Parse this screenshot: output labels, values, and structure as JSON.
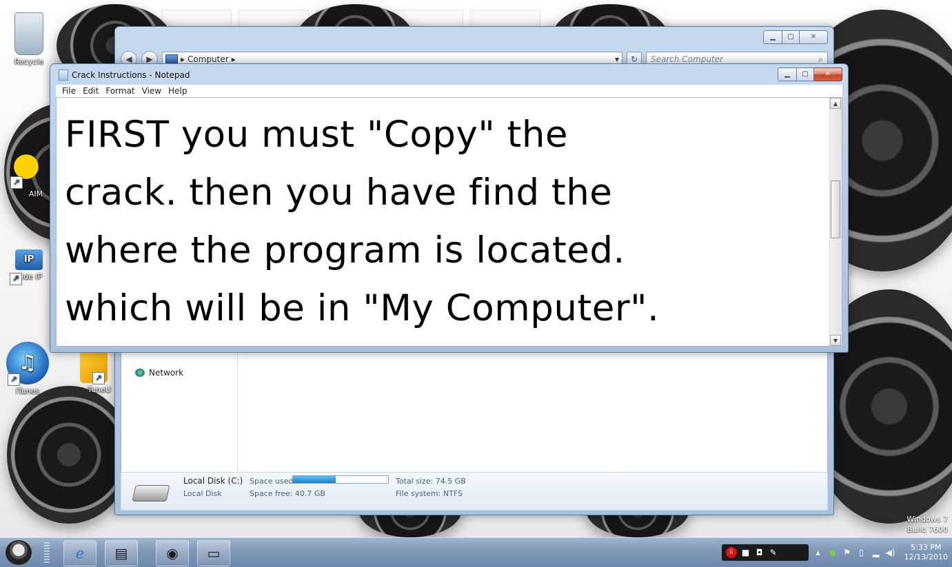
{
  "desktop": {
    "icons": [
      {
        "label": "Recycle",
        "key": "recycle"
      },
      {
        "label": "AIM",
        "key": "aim"
      },
      {
        "label": "Hide IP",
        "key": "hideip"
      },
      {
        "label": "iTunes",
        "key": "itunes"
      },
      {
        "label": "TuneU",
        "key": "tuneup"
      }
    ],
    "watermark": {
      "line1": "Windows 7",
      "line2": "Build 7600"
    }
  },
  "explorer": {
    "address": "Computer",
    "search_placeholder": "Search Computer",
    "nav_item_network": "Network",
    "details": {
      "drive_name": "Local Disk (C:)",
      "drive_type": "Local Disk",
      "space_used_label": "Space used:",
      "space_free": "Space free: 40.7 GB",
      "total_size": "Total size: 74.5 GB",
      "file_system": "File system: NTFS",
      "used_fraction": 0.45
    }
  },
  "notepad": {
    "title": "Crack Instructions - Notepad",
    "menu": [
      "File",
      "Edit",
      "Format",
      "View",
      "Help"
    ],
    "content": "FIRST you must \"Copy\" the\ncrack. then you have find the\nwhere the program is located.\nwhich will be in \"My Computer\"."
  },
  "taskbar": {
    "clock_time": "5:33 PM",
    "clock_date": "12/13/2010"
  },
  "colors": {
    "accent": "#1a7fc9",
    "close_red": "#c4442a"
  }
}
